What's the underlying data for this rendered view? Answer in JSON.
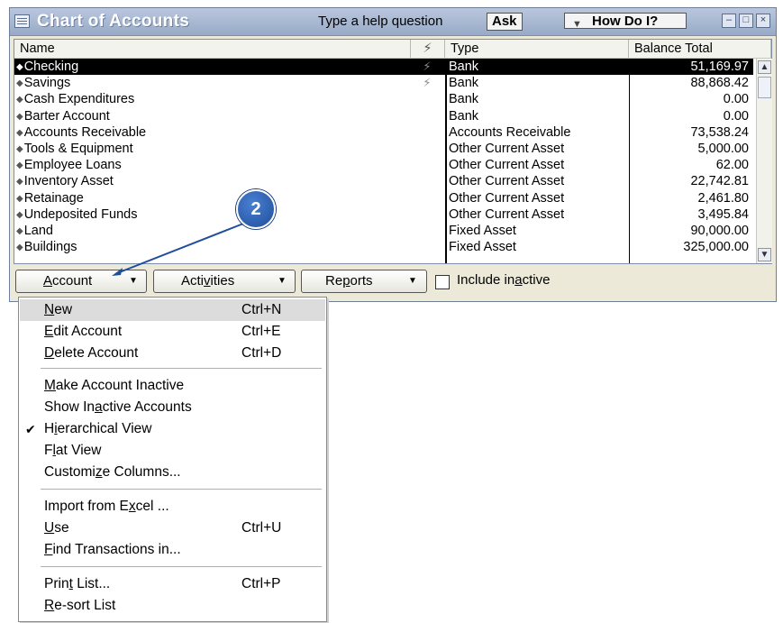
{
  "window": {
    "title": "Chart of Accounts",
    "help_label": "Type a help question",
    "ask_label": "Ask",
    "howdoi_label": "How Do I?"
  },
  "columns": {
    "name": "Name",
    "type": "Type",
    "balance": "Balance Total"
  },
  "accounts": [
    {
      "name": "Checking",
      "flag": "⚡",
      "type": "Bank",
      "balance": "51,169.97",
      "selected": true
    },
    {
      "name": "Savings",
      "flag": "⚡",
      "type": "Bank",
      "balance": "88,868.42"
    },
    {
      "name": "Cash Expenditures",
      "type": "Bank",
      "balance": "0.00"
    },
    {
      "name": "Barter Account",
      "type": "Bank",
      "balance": "0.00"
    },
    {
      "name": "Accounts Receivable",
      "type": "Accounts Receivable",
      "balance": "73,538.24"
    },
    {
      "name": "Tools & Equipment",
      "type": "Other Current Asset",
      "balance": "5,000.00"
    },
    {
      "name": "Employee Loans",
      "type": "Other Current Asset",
      "balance": "62.00"
    },
    {
      "name": "Inventory Asset",
      "type": "Other Current Asset",
      "balance": "22,742.81"
    },
    {
      "name": "Retainage",
      "type": "Other Current Asset",
      "balance": "2,461.80"
    },
    {
      "name": "Undeposited Funds",
      "type": "Other Current Asset",
      "balance": "3,495.84"
    },
    {
      "name": "Land",
      "type": "Fixed Asset",
      "balance": "90,000.00"
    },
    {
      "name": "Buildings",
      "type": "Fixed Asset",
      "balance": "325,000.00"
    }
  ],
  "buttons": {
    "account_pre": "",
    "account_u": "A",
    "account_post": "ccount",
    "activities_pre": "Acti",
    "activities_u": "v",
    "activities_post": "ities",
    "reports_pre": "Re",
    "reports_u": "p",
    "reports_post": "orts",
    "include_pre": "Include in",
    "include_u": "a",
    "include_post": "ctive",
    "include_checked": false
  },
  "callout_number": "2",
  "menu": {
    "items": [
      {
        "pre": "",
        "u": "N",
        "post": "ew",
        "shortcut": "Ctrl+N"
      },
      {
        "pre": "",
        "u": "E",
        "post": "dit Account",
        "shortcut": "Ctrl+E"
      },
      {
        "pre": "",
        "u": "D",
        "post": "elete Account",
        "shortcut": "Ctrl+D"
      },
      {
        "pre": "",
        "u": "M",
        "post": "ake Account Inactive",
        "shortcut": ""
      },
      {
        "pre": "Show In",
        "u": "a",
        "post": "ctive Accounts",
        "shortcut": ""
      },
      {
        "pre": "H",
        "u": "i",
        "post": "erarchical View",
        "shortcut": "",
        "checked": true
      },
      {
        "pre": "F",
        "u": "l",
        "post": "at View",
        "shortcut": ""
      },
      {
        "pre": "Customi",
        "u": "z",
        "post": "e Columns...",
        "shortcut": ""
      },
      {
        "pre": "Import from E",
        "u": "x",
        "post": "cel ...",
        "shortcut": ""
      },
      {
        "pre": "",
        "u": "U",
        "post": "se",
        "shortcut": "Ctrl+U"
      },
      {
        "pre": "",
        "u": "F",
        "post": "ind Transactions in...",
        "shortcut": ""
      },
      {
        "pre": "Prin",
        "u": "t",
        "post": " List...",
        "shortcut": "Ctrl+P"
      },
      {
        "pre": "",
        "u": "R",
        "post": "e-sort List",
        "shortcut": ""
      }
    ]
  },
  "colors": {
    "selection": "#000000",
    "callout": "#1f4e9c",
    "titlebar": "#98aac7"
  }
}
